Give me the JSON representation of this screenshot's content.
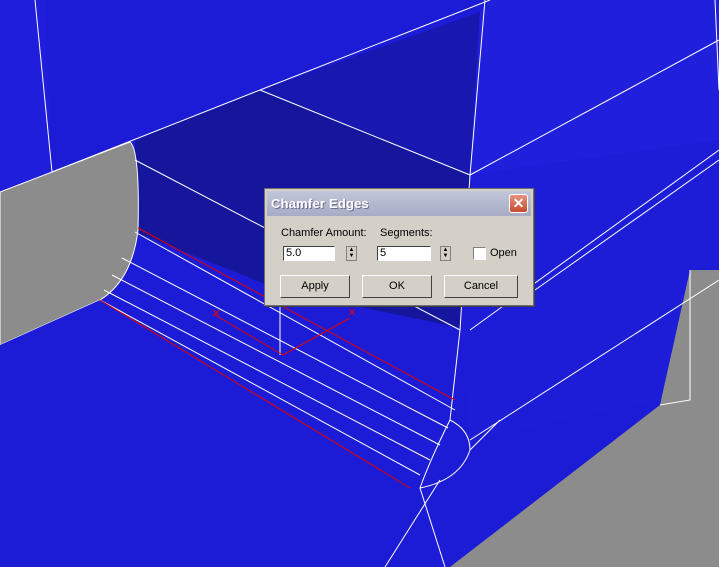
{
  "viewport": {
    "colors": {
      "background": "#1c1cd6",
      "dark_face": "#16169c",
      "gray_face": "#8c8c8c",
      "edge": "#ffffff",
      "selected_edge": "#e00000"
    }
  },
  "dialog": {
    "title": "Chamfer Edges",
    "chamfer_amount_label": "Chamfer Amount:",
    "chamfer_amount_value": "5.0",
    "segments_label": "Segments:",
    "segments_value": "5",
    "open_label": "Open",
    "open_checked": false,
    "apply_label": "Apply",
    "ok_label": "OK",
    "cancel_label": "Cancel",
    "close_icon": "close-x-icon",
    "spinner_icon": "spinner-arrows-icon"
  }
}
